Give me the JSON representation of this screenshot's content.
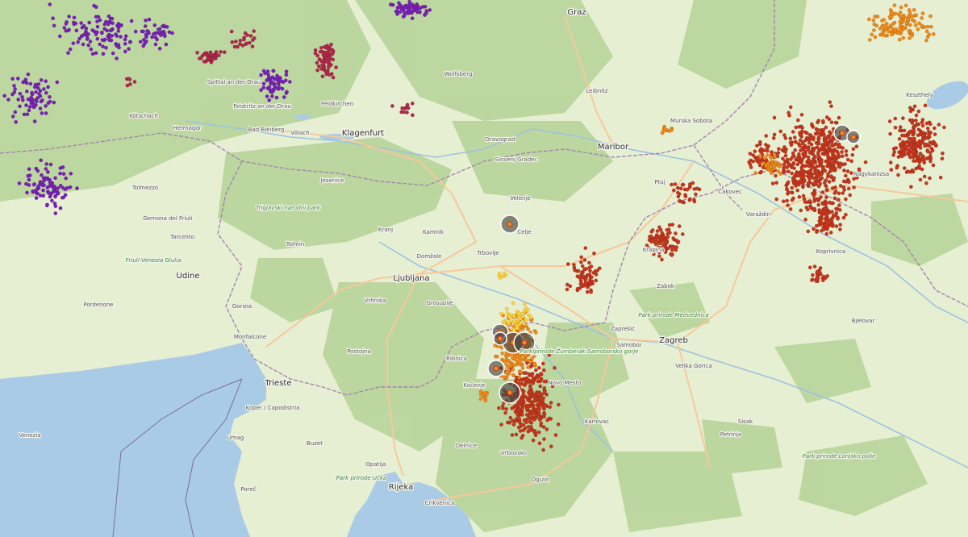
{
  "map": {
    "colors": {
      "land": "#e6efd2",
      "forest": "#b8d49a",
      "water": "#aacbe6",
      "border": "#9a7da0",
      "road_major": "#f7c89a",
      "road_minor": "#ffffff",
      "strike_purple": "#7a20b8",
      "strike_maroon": "#b0284a",
      "strike_red": "#c7361c",
      "strike_orange": "#f08a18",
      "strike_yellow": "#ffd23a"
    },
    "places": [
      {
        "name": "Graz",
        "type": "big"
      },
      {
        "name": "Klagenfurt",
        "type": "big"
      },
      {
        "name": "Maribor",
        "type": "big"
      },
      {
        "name": "Ljubljana",
        "type": "big"
      },
      {
        "name": "Zagreb",
        "type": "big"
      },
      {
        "name": "Trieste",
        "type": "big"
      },
      {
        "name": "Rijeka",
        "type": "big"
      },
      {
        "name": "Udine",
        "type": "big"
      },
      {
        "name": "Celje",
        "type": "town"
      },
      {
        "name": "Kranj",
        "type": "town"
      },
      {
        "name": "Karlovac",
        "type": "town"
      },
      {
        "name": "Varaždin",
        "type": "town"
      },
      {
        "name": "Bjelovar",
        "type": "town"
      },
      {
        "name": "Sisak",
        "type": "town"
      },
      {
        "name": "Koper / Capodistria",
        "type": "town"
      },
      {
        "name": "Pordenone",
        "type": "town"
      },
      {
        "name": "Venezia",
        "type": "town"
      },
      {
        "name": "Villach",
        "type": "town"
      },
      {
        "name": "Spittal an der Drau",
        "type": "town"
      },
      {
        "name": "Velenje",
        "type": "town"
      },
      {
        "name": "Novo Mesto",
        "type": "town"
      },
      {
        "name": "Kočevje",
        "type": "town"
      },
      {
        "name": "Ribnica",
        "type": "town"
      },
      {
        "name": "Nagykanizsa",
        "type": "town"
      },
      {
        "name": "Keszthely",
        "type": "town"
      },
      {
        "name": "Murska Sobota",
        "type": "town"
      },
      {
        "name": "Ptuj",
        "type": "town"
      },
      {
        "name": "Čakovec",
        "type": "town"
      },
      {
        "name": "Koprivnica",
        "type": "town"
      },
      {
        "name": "Wolfsberg",
        "type": "town"
      },
      {
        "name": "Leibnitz",
        "type": "town"
      },
      {
        "name": "Jesenice",
        "type": "town"
      },
      {
        "name": "Tolmin",
        "type": "town"
      },
      {
        "name": "Postojna",
        "type": "town"
      },
      {
        "name": "Gorizia",
        "type": "town"
      },
      {
        "name": "Monfalcone",
        "type": "town"
      },
      {
        "name": "Tarcento",
        "type": "town"
      },
      {
        "name": "Gemona del Friuli",
        "type": "town"
      },
      {
        "name": "Tolmezzo",
        "type": "town"
      },
      {
        "name": "Samobor",
        "type": "town"
      },
      {
        "name": "Zaprešić",
        "type": "town"
      },
      {
        "name": "Krapina",
        "type": "town"
      },
      {
        "name": "Zabok",
        "type": "town"
      },
      {
        "name": "Delnice",
        "type": "town"
      },
      {
        "name": "Ogulin",
        "type": "town"
      },
      {
        "name": "Vrbovsko",
        "type": "town"
      },
      {
        "name": "Crikvenica",
        "type": "town"
      },
      {
        "name": "Opatija",
        "type": "town"
      },
      {
        "name": "Poreč",
        "type": "town"
      },
      {
        "name": "Umag",
        "type": "town"
      },
      {
        "name": "Buzet",
        "type": "town"
      },
      {
        "name": "Petrinja",
        "type": "town"
      },
      {
        "name": "Velika Gorica",
        "type": "town"
      },
      {
        "name": "Vrhnika",
        "type": "town"
      },
      {
        "name": "Grosuplje",
        "type": "town"
      },
      {
        "name": "Trbovlje",
        "type": "town"
      },
      {
        "name": "Domžale",
        "type": "town"
      },
      {
        "name": "Kamnik",
        "type": "town"
      },
      {
        "name": "Slovenj Gradec",
        "type": "town"
      },
      {
        "name": "Dravograd",
        "type": "town"
      },
      {
        "name": "Feldkirchen",
        "type": "town"
      },
      {
        "name": "Bad Bleiberg",
        "type": "town"
      },
      {
        "name": "Hermagor",
        "type": "town"
      },
      {
        "name": "Kötschach",
        "type": "town"
      },
      {
        "name": "Feistritz an der Drau",
        "type": "town"
      },
      {
        "name": "Triglavski narodni park",
        "type": "park"
      },
      {
        "name": "Friuli-Venezia Giulia",
        "type": "park"
      },
      {
        "name": "Park prirode Medvednica",
        "type": "park"
      },
      {
        "name": "Park prirode Žumberak Samoborsko gorje",
        "type": "park"
      },
      {
        "name": "Park prirode Učka",
        "type": "park"
      },
      {
        "name": "Park prirode Lonjsko polje",
        "type": "park"
      }
    ]
  }
}
